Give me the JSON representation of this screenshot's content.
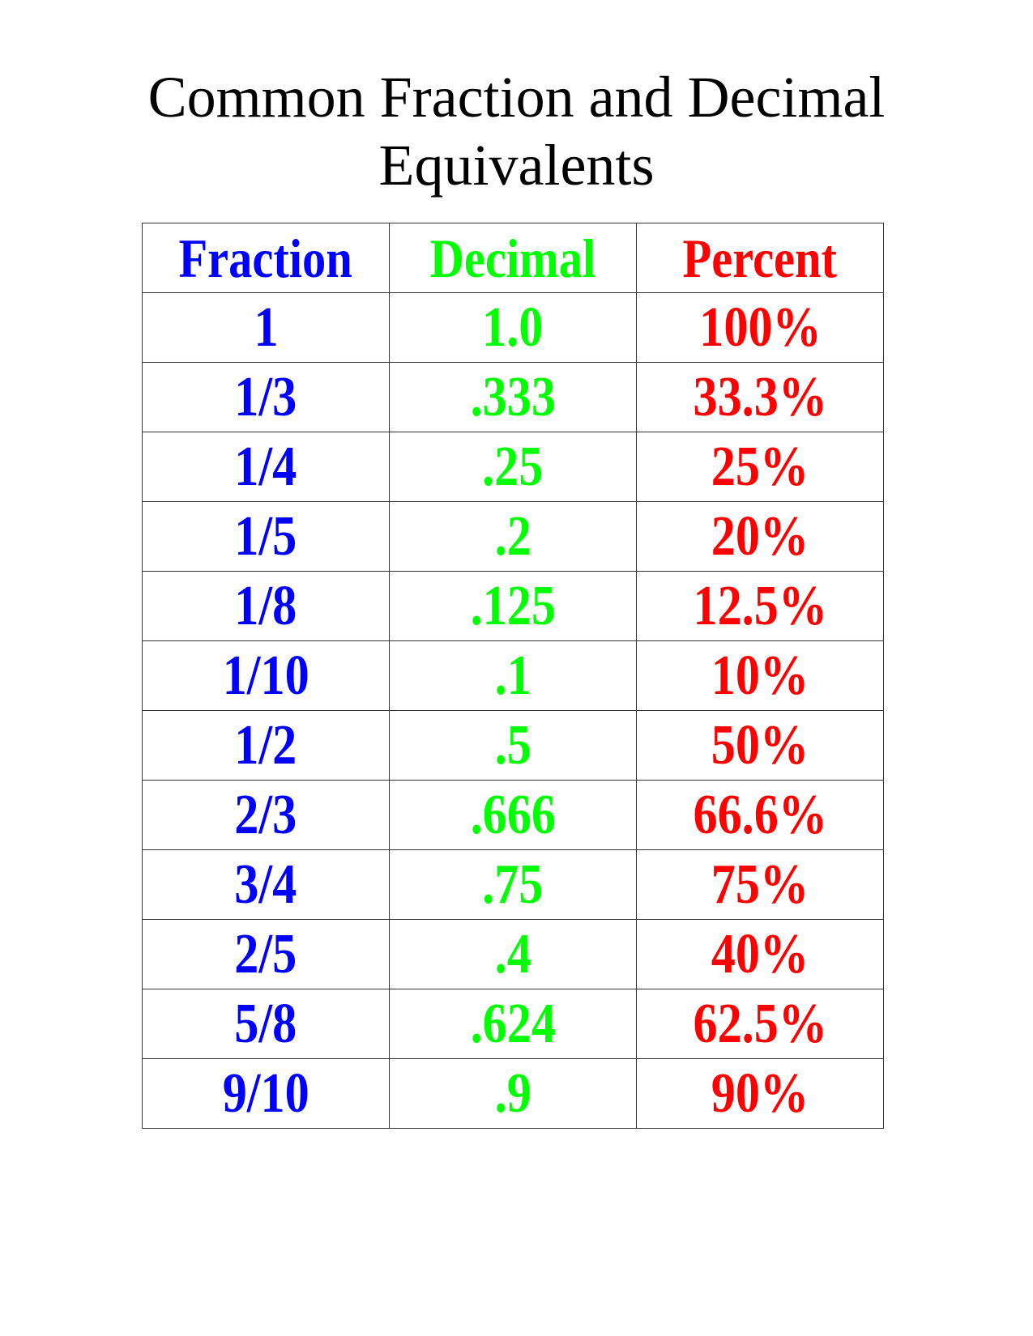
{
  "title": {
    "line1": "Common Fraction and Decimal",
    "line2": "Equivalents"
  },
  "colors": {
    "fraction": "#0000ff",
    "decimal": "#00ff00",
    "percent": "#ff0000"
  },
  "table": {
    "headers": [
      "Fraction",
      "Decimal",
      "Percent"
    ],
    "rows": [
      [
        "1",
        "1.0",
        "100%"
      ],
      [
        "1/3",
        ".333",
        "33.3%"
      ],
      [
        "1/4",
        ".25",
        "25%"
      ],
      [
        "1/5",
        ".2",
        "20%"
      ],
      [
        "1/8",
        ".125",
        "12.5%"
      ],
      [
        "1/10",
        ".1",
        "10%"
      ],
      [
        "1/2",
        ".5",
        "50%"
      ],
      [
        "2/3",
        ".666",
        "66.6%"
      ],
      [
        "3/4",
        ".75",
        "75%"
      ],
      [
        "2/5",
        ".4",
        "40%"
      ],
      [
        "5/8",
        ".624",
        "62.5%"
      ],
      [
        "9/10",
        ".9",
        "90%"
      ]
    ]
  }
}
